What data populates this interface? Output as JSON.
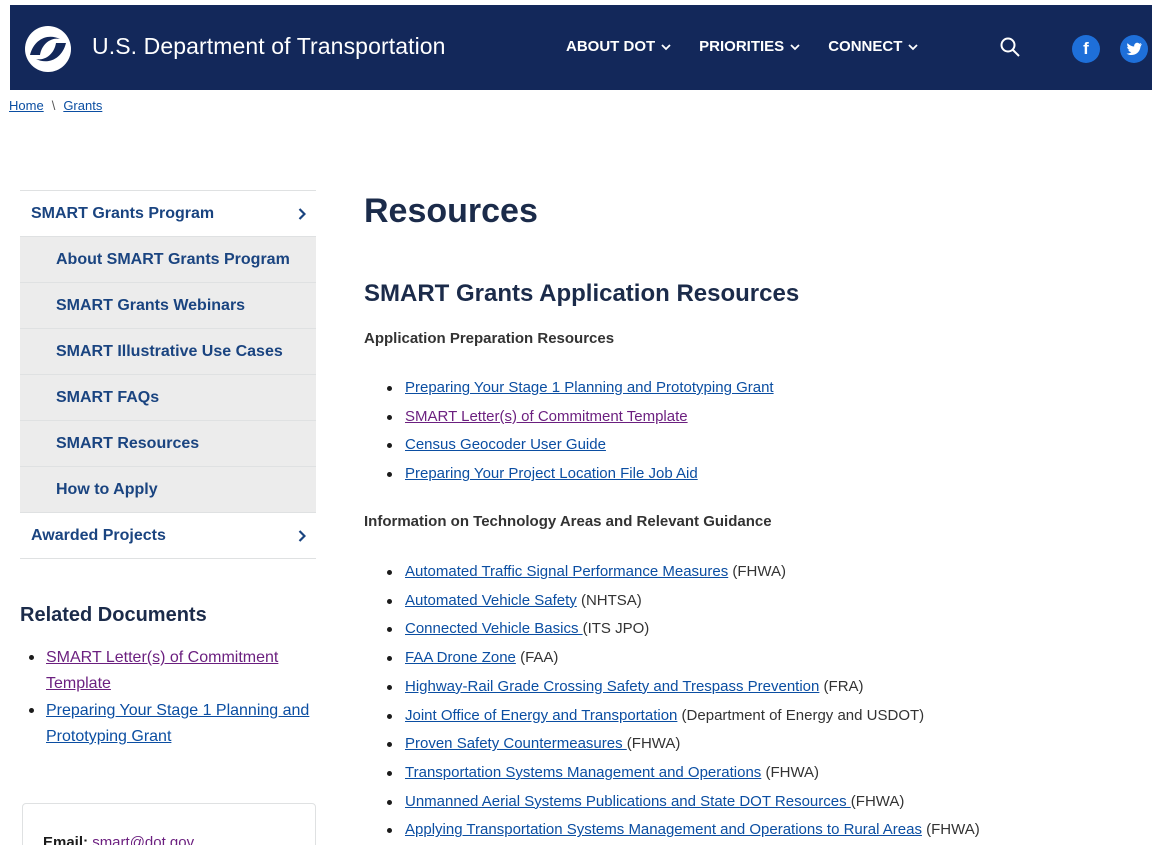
{
  "header": {
    "site_name": "U.S. Department of Transportation",
    "nav": [
      "ABOUT DOT",
      "PRIORITIES",
      "CONNECT"
    ],
    "bg_color": "#13285a",
    "social": [
      "f",
      "t"
    ]
  },
  "breadcrumb": {
    "home": "Home",
    "sep": "\\",
    "current": "Grants"
  },
  "sidebar": {
    "items": [
      {
        "label": "SMART Grants Program",
        "arrow": true
      },
      {
        "label": "About SMART Grants Program",
        "sub": true
      },
      {
        "label": "SMART Grants Webinars",
        "sub": true
      },
      {
        "label": "SMART Illustrative Use Cases",
        "sub": true
      },
      {
        "label": "SMART FAQs",
        "sub": true
      },
      {
        "label": "SMART Resources",
        "sub": true
      },
      {
        "label": "How to Apply",
        "sub": true
      },
      {
        "label": "Awarded Projects",
        "arrow": true
      }
    ],
    "related_title": "Related Documents",
    "related": [
      "SMART Letter(s) of Commitment Template",
      "Preparing Your Stage 1 Planning and Prototyping Grant"
    ],
    "contact": {
      "label": "Email:",
      "email": "smart@dot.gov"
    }
  },
  "main": {
    "title": "Resources",
    "section_title": "SMART Grants Application Resources",
    "prep_heading": "Application Preparation Resources",
    "prep_links": [
      "Preparing Your Stage 1 Planning and Prototyping Grant",
      "SMART Letter(s) of Commitment Template",
      "Census Geocoder User Guide",
      "Preparing Your Project Location File Job Aid"
    ],
    "tech_heading": "Information on Technology Areas and Relevant Guidance",
    "tech_links": [
      {
        "link": "Automated Traffic Signal Performance Measures",
        "suffix": " (FHWA)"
      },
      {
        "link": "Automated Vehicle Safety",
        "suffix": " (NHTSA)"
      },
      {
        "link": "Connected Vehicle Basics ",
        "suffix": "(ITS JPO)"
      },
      {
        "link": "FAA Drone Zone",
        "suffix": " (FAA)"
      },
      {
        "link": "Highway-Rail Grade Crossing Safety and Trespass Prevention",
        "suffix": " (FRA)"
      },
      {
        "link": "Joint Office of Energy and Transportation",
        "suffix": " (Department of Energy and USDOT)"
      },
      {
        "link": "Proven Safety Countermeasures ",
        "suffix": "(FHWA)"
      },
      {
        "link": "Transportation Systems Management and Operations",
        "suffix": " (FHWA)"
      },
      {
        "link": "Unmanned Aerial Systems Publications and State DOT Resources ",
        "suffix": "(FHWA)"
      },
      {
        "link": "Applying Transportation Systems Management and Operations to Rural Areas",
        "suffix": " (FHWA)"
      }
    ]
  }
}
